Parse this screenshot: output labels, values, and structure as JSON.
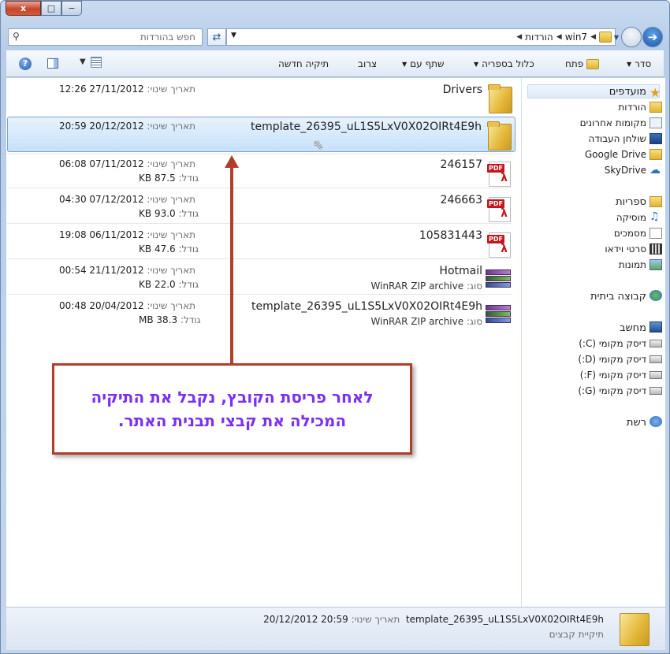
{
  "window": {
    "close_label": "x",
    "max_label": "□",
    "min_label": "−"
  },
  "address": {
    "search_placeholder": "חפש בהורדות",
    "crumbs": [
      "win7",
      "הורדות"
    ]
  },
  "toolbar": {
    "organize": "סדר",
    "open": "פתח",
    "include_in_library": "כלול בספריה",
    "share_with": "שתף עם",
    "burn": "צרוב",
    "new_folder": "תיקיה חדשה"
  },
  "files": [
    {
      "name": "Drivers",
      "type": "folder",
      "date_label": "תאריך שינוי:",
      "date": "27/11/2012 12:26"
    },
    {
      "name": "template_26395_uL1S5LxV0X02OIRt4E9h",
      "type": "folder",
      "date_label": "תאריך שינוי:",
      "date": "20/12/2012 20:59",
      "selected": true
    },
    {
      "name": "246157",
      "type": "pdf",
      "date_label": "תאריך שינוי:",
      "date": "07/11/2012 06:08",
      "size_label": "גודל:",
      "size": "87.5 KB"
    },
    {
      "name": "246663",
      "type": "pdf",
      "date_label": "תאריך שינוי:",
      "date": "07/12/2012 04:30",
      "size_label": "גודל:",
      "size": "93.0 KB"
    },
    {
      "name": "105831443",
      "type": "pdf",
      "date_label": "תאריך שינוי:",
      "date": "06/11/2012 19:08",
      "size_label": "גודל:",
      "size": "47.6 KB"
    },
    {
      "name": "Hotmail",
      "type": "rar",
      "type_label": "סוג:",
      "type_value": "WinRAR ZIP archive",
      "date_label": "תאריך שינוי:",
      "date": "21/11/2012 00:54",
      "size_label": "גודל:",
      "size": "22.0 KB"
    },
    {
      "name": "template_26395_uL1S5LxV0X02OIRt4E9h",
      "type": "rar",
      "type_label": "סוג:",
      "type_value": "WinRAR ZIP archive",
      "date_label": "תאריך שינוי:",
      "date": "20/04/2012 00:48",
      "size_label": "גודל:",
      "size": "38.3 MB"
    }
  ],
  "nav": {
    "favorites": "מועדפים",
    "downloads": "הורדות",
    "recent_places": "מקומות אחרונים",
    "desktop": "שולחן העבודה",
    "google_drive": "Google Drive",
    "skydrive": "SkyDrive",
    "libraries": "ספריות",
    "music": "מוסיקה",
    "documents": "מסמכים",
    "videos": "סרטי וידאו",
    "pictures": "תמונות",
    "homegroup": "קבוצה ביתית",
    "computer": "מחשב",
    "drive_c": "דיסק מקומי (C:)",
    "drive_d": "דיסק מקומי (D:)",
    "drive_f": "דיסק מקומי (F:)",
    "drive_g": "דיסק מקומי (G:)",
    "network": "רשת"
  },
  "callout": {
    "line1": "לאחר פריסת הקובץ, נקבל את התיקיה",
    "line2": "המכילה את קבצי תבנית האתר."
  },
  "details": {
    "name": "template_26395_uL1S5LxV0X02OIRt4E9h",
    "date_label": "תאריך שינוי:",
    "date": "20:59 20/12/2012",
    "type": "תיקיית קבצים"
  },
  "colors": {
    "callout_text": "#7b2ff2",
    "callout_border": "#b03e2a",
    "selection": "#c6e1fa"
  }
}
